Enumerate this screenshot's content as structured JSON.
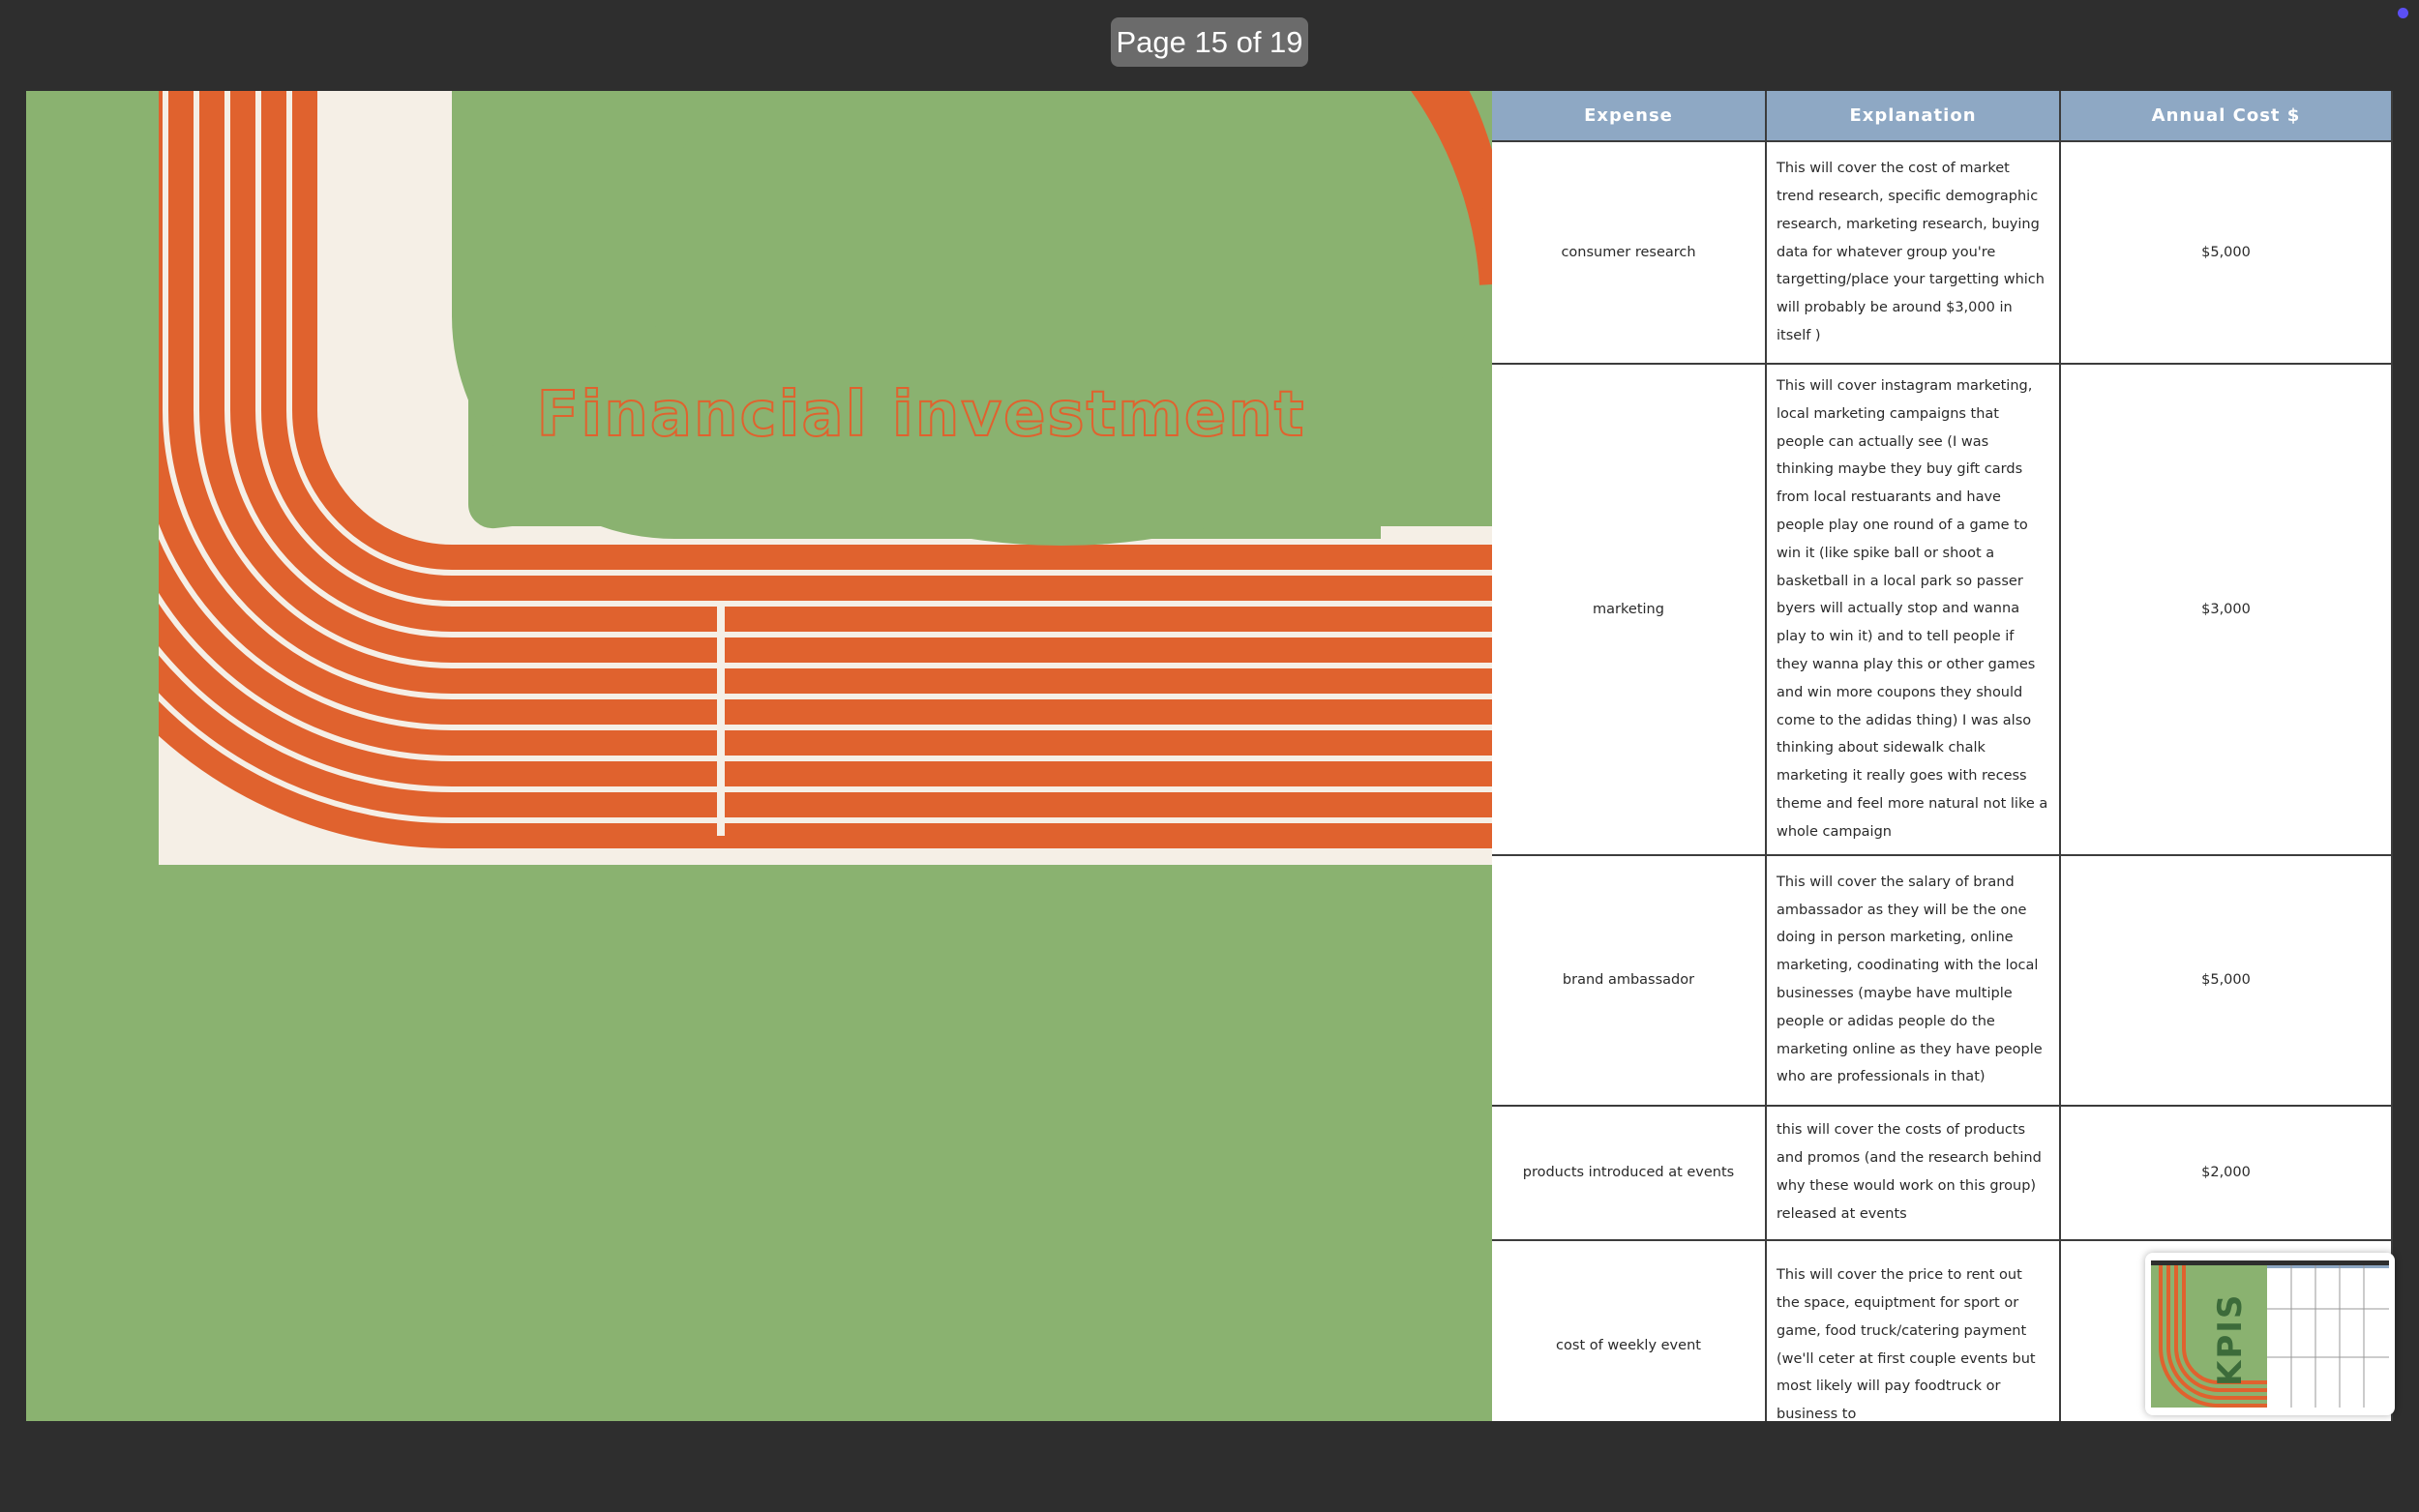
{
  "viewer": {
    "page_indicator": "Page 15 of 19",
    "accent_dot_color": "#5b4ff5"
  },
  "slide": {
    "title": "Financial investment",
    "background_color": "#8ab270",
    "track_color": "#e0622e",
    "table": {
      "headers": [
        "Expense",
        "Explanation",
        "Annual Cost $"
      ],
      "header_color": "#8ea8c4",
      "rows": [
        {
          "expense": "consumer research",
          "explanation": "This will cover the cost of market trend research, specific demographic research, marketing research, buying data for whatever group you're targetting/place your targetting which will probably be around $3,000 in itself )",
          "cost": "$5,000"
        },
        {
          "expense": "marketing",
          "explanation": "This will cover instagram marketing, local marketing campaigns that people can actually see (I was thinking maybe they buy gift cards from local restuarants and have people play one round of a game to win it (like spike ball or shoot a basketball in a local park so passer byers will actually stop and wanna play to win it) and to tell people if they wanna play this or other games and win more coupons they should come to the adidas thing) I was also thinking about sidewalk chalk marketing it really goes with recess theme and feel more natural not like a whole campaign",
          "cost": "$3,000"
        },
        {
          "expense": "brand ambassador",
          "explanation": "This will cover the salary of brand ambassador as they will be the one doing in person marketing, online marketing, coodinating with the local businesses (maybe have multiple people or adidas people do the marketing online as they have people who are professionals in that)",
          "cost": "$5,000"
        },
        {
          "expense": "products introduced at events",
          "explanation": "this will cover the costs of products and promos (and the research behind why these would work on this group) released at events",
          "cost": "$2,000"
        },
        {
          "expense": "cost of weekly event",
          "explanation": "This will cover the price to rent out the space, equiptment for sport or game, food truck/catering payment (we'll ceter at first couple events but most likely will pay foodtruck or business to",
          "cost": ""
        }
      ]
    }
  },
  "thumbnail": {
    "title": "KPIS",
    "icon": "next-slide-preview"
  }
}
